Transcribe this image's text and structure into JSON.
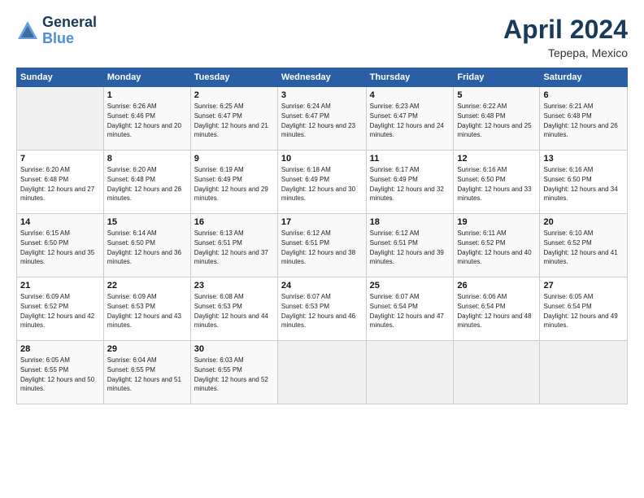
{
  "header": {
    "logo_general": "General",
    "logo_blue": "Blue",
    "month_title": "April 2024",
    "location": "Tepepa, Mexico"
  },
  "days_of_week": [
    "Sunday",
    "Monday",
    "Tuesday",
    "Wednesday",
    "Thursday",
    "Friday",
    "Saturday"
  ],
  "weeks": [
    [
      {
        "num": "",
        "empty": true
      },
      {
        "num": "1",
        "sunrise": "Sunrise: 6:26 AM",
        "sunset": "Sunset: 6:46 PM",
        "daylight": "Daylight: 12 hours and 20 minutes."
      },
      {
        "num": "2",
        "sunrise": "Sunrise: 6:25 AM",
        "sunset": "Sunset: 6:47 PM",
        "daylight": "Daylight: 12 hours and 21 minutes."
      },
      {
        "num": "3",
        "sunrise": "Sunrise: 6:24 AM",
        "sunset": "Sunset: 6:47 PM",
        "daylight": "Daylight: 12 hours and 23 minutes."
      },
      {
        "num": "4",
        "sunrise": "Sunrise: 6:23 AM",
        "sunset": "Sunset: 6:47 PM",
        "daylight": "Daylight: 12 hours and 24 minutes."
      },
      {
        "num": "5",
        "sunrise": "Sunrise: 6:22 AM",
        "sunset": "Sunset: 6:48 PM",
        "daylight": "Daylight: 12 hours and 25 minutes."
      },
      {
        "num": "6",
        "sunrise": "Sunrise: 6:21 AM",
        "sunset": "Sunset: 6:48 PM",
        "daylight": "Daylight: 12 hours and 26 minutes."
      }
    ],
    [
      {
        "num": "7",
        "sunrise": "Sunrise: 6:20 AM",
        "sunset": "Sunset: 6:48 PM",
        "daylight": "Daylight: 12 hours and 27 minutes."
      },
      {
        "num": "8",
        "sunrise": "Sunrise: 6:20 AM",
        "sunset": "Sunset: 6:48 PM",
        "daylight": "Daylight: 12 hours and 28 minutes."
      },
      {
        "num": "9",
        "sunrise": "Sunrise: 6:19 AM",
        "sunset": "Sunset: 6:49 PM",
        "daylight": "Daylight: 12 hours and 29 minutes."
      },
      {
        "num": "10",
        "sunrise": "Sunrise: 6:18 AM",
        "sunset": "Sunset: 6:49 PM",
        "daylight": "Daylight: 12 hours and 30 minutes."
      },
      {
        "num": "11",
        "sunrise": "Sunrise: 6:17 AM",
        "sunset": "Sunset: 6:49 PM",
        "daylight": "Daylight: 12 hours and 32 minutes."
      },
      {
        "num": "12",
        "sunrise": "Sunrise: 6:16 AM",
        "sunset": "Sunset: 6:50 PM",
        "daylight": "Daylight: 12 hours and 33 minutes."
      },
      {
        "num": "13",
        "sunrise": "Sunrise: 6:16 AM",
        "sunset": "Sunset: 6:50 PM",
        "daylight": "Daylight: 12 hours and 34 minutes."
      }
    ],
    [
      {
        "num": "14",
        "sunrise": "Sunrise: 6:15 AM",
        "sunset": "Sunset: 6:50 PM",
        "daylight": "Daylight: 12 hours and 35 minutes."
      },
      {
        "num": "15",
        "sunrise": "Sunrise: 6:14 AM",
        "sunset": "Sunset: 6:50 PM",
        "daylight": "Daylight: 12 hours and 36 minutes."
      },
      {
        "num": "16",
        "sunrise": "Sunrise: 6:13 AM",
        "sunset": "Sunset: 6:51 PM",
        "daylight": "Daylight: 12 hours and 37 minutes."
      },
      {
        "num": "17",
        "sunrise": "Sunrise: 6:12 AM",
        "sunset": "Sunset: 6:51 PM",
        "daylight": "Daylight: 12 hours and 38 minutes."
      },
      {
        "num": "18",
        "sunrise": "Sunrise: 6:12 AM",
        "sunset": "Sunset: 6:51 PM",
        "daylight": "Daylight: 12 hours and 39 minutes."
      },
      {
        "num": "19",
        "sunrise": "Sunrise: 6:11 AM",
        "sunset": "Sunset: 6:52 PM",
        "daylight": "Daylight: 12 hours and 40 minutes."
      },
      {
        "num": "20",
        "sunrise": "Sunrise: 6:10 AM",
        "sunset": "Sunset: 6:52 PM",
        "daylight": "Daylight: 12 hours and 41 minutes."
      }
    ],
    [
      {
        "num": "21",
        "sunrise": "Sunrise: 6:09 AM",
        "sunset": "Sunset: 6:52 PM",
        "daylight": "Daylight: 12 hours and 42 minutes."
      },
      {
        "num": "22",
        "sunrise": "Sunrise: 6:09 AM",
        "sunset": "Sunset: 6:53 PM",
        "daylight": "Daylight: 12 hours and 43 minutes."
      },
      {
        "num": "23",
        "sunrise": "Sunrise: 6:08 AM",
        "sunset": "Sunset: 6:53 PM",
        "daylight": "Daylight: 12 hours and 44 minutes."
      },
      {
        "num": "24",
        "sunrise": "Sunrise: 6:07 AM",
        "sunset": "Sunset: 6:53 PM",
        "daylight": "Daylight: 12 hours and 46 minutes."
      },
      {
        "num": "25",
        "sunrise": "Sunrise: 6:07 AM",
        "sunset": "Sunset: 6:54 PM",
        "daylight": "Daylight: 12 hours and 47 minutes."
      },
      {
        "num": "26",
        "sunrise": "Sunrise: 6:06 AM",
        "sunset": "Sunset: 6:54 PM",
        "daylight": "Daylight: 12 hours and 48 minutes."
      },
      {
        "num": "27",
        "sunrise": "Sunrise: 6:05 AM",
        "sunset": "Sunset: 6:54 PM",
        "daylight": "Daylight: 12 hours and 49 minutes."
      }
    ],
    [
      {
        "num": "28",
        "sunrise": "Sunrise: 6:05 AM",
        "sunset": "Sunset: 6:55 PM",
        "daylight": "Daylight: 12 hours and 50 minutes."
      },
      {
        "num": "29",
        "sunrise": "Sunrise: 6:04 AM",
        "sunset": "Sunset: 6:55 PM",
        "daylight": "Daylight: 12 hours and 51 minutes."
      },
      {
        "num": "30",
        "sunrise": "Sunrise: 6:03 AM",
        "sunset": "Sunset: 6:55 PM",
        "daylight": "Daylight: 12 hours and 52 minutes."
      },
      {
        "num": "",
        "empty": true
      },
      {
        "num": "",
        "empty": true
      },
      {
        "num": "",
        "empty": true
      },
      {
        "num": "",
        "empty": true
      }
    ]
  ]
}
